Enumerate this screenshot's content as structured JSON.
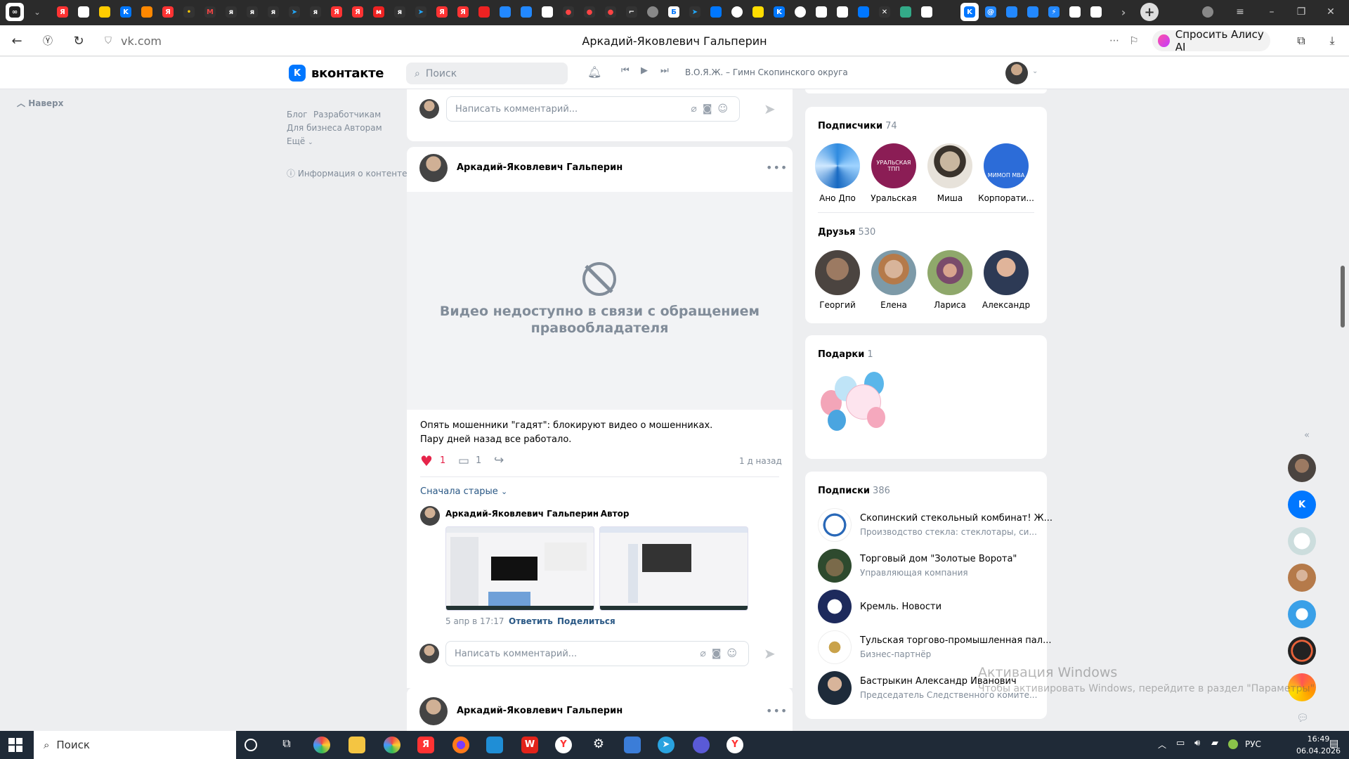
{
  "browser": {
    "url": "vk.com",
    "page_title": "Аркадий-Яковлевич Гальперин",
    "alice_button": "Спросить Алису AI"
  },
  "vk": {
    "logo_text": "вконтакте",
    "search_placeholder": "Поиск",
    "now_playing": "В.О.Я.Ж. – Гимн Скопинского округа"
  },
  "left": {
    "back_to_top": "Наверх",
    "links": [
      "Блог",
      "Разработчикам",
      "Для бизнеса",
      "Авторам",
      "Ещё"
    ],
    "content_info": "Информация о контенте"
  },
  "feed": {
    "comment_placeholder": "Написать комментарий...",
    "post_author": "Аркадий-Яковлевич Гальперин",
    "video_unavailable": "Видео недоступно в связи с обращением правообладателя",
    "post_text_line1": "Опять мошенники \"гадят\": блокируют видео о мошенниках.",
    "post_text_line2": "Пару дней назад все работало.",
    "likes": "1",
    "comments": "1",
    "time_ago": "1 д назад",
    "sort_label": "Сначала старые",
    "comment": {
      "author": "Аркадий-Яковлевич Гальперин",
      "badge": "· Автор",
      "date": "5 апр в 17:17",
      "reply": "Ответить",
      "share": "Поделиться"
    },
    "next_post_author": "Аркадий-Яковлевич Гальперин"
  },
  "right": {
    "followers": {
      "title": "Подписчики",
      "count": "74",
      "items": [
        {
          "name": "Ано Дпо"
        },
        {
          "name": "Уральская"
        },
        {
          "name": "Миша"
        },
        {
          "name": "Корпорати..."
        }
      ],
      "ural_logo_text": "УРАЛЬСКАЯ ТПП",
      "mimop_logo_text": "МИМОП MBA"
    },
    "friends": {
      "title": "Друзья",
      "count": "530",
      "items": [
        {
          "name": "Георгий"
        },
        {
          "name": "Елена"
        },
        {
          "name": "Лариса"
        },
        {
          "name": "Александр"
        }
      ]
    },
    "gifts": {
      "title": "Подарки",
      "count": "1"
    },
    "subscriptions": {
      "title": "Подписки",
      "count": "386",
      "items": [
        {
          "name": "Скопинский стекольный комбинат! Ж...",
          "desc": "Производство стекла: стеклотары, си..."
        },
        {
          "name": "Торговый дом \"Золотые Ворота\"",
          "desc": "Управляющая компания"
        },
        {
          "name": "Кремль. Новости",
          "desc": ""
        },
        {
          "name": "Тульская торгово-промышленная пал...",
          "desc": "Бизнес-партнёр"
        },
        {
          "name": "Бастрыкин Александр Иванович",
          "desc": "Председатель Следственного комите..."
        }
      ]
    }
  },
  "windows": {
    "activation_title": "Активация Windows",
    "activation_text": "Чтобы активировать Windows, перейдите в раздел \"Параметры\"",
    "taskbar_search": "Поиск",
    "lang": "РУС",
    "time": "16:49",
    "date": "06.04.2026"
  },
  "colors": {
    "vk_blue": "#0077ff",
    "link": "#2a5885",
    "muted": "#818c99",
    "page_bg": "#edeef0"
  }
}
